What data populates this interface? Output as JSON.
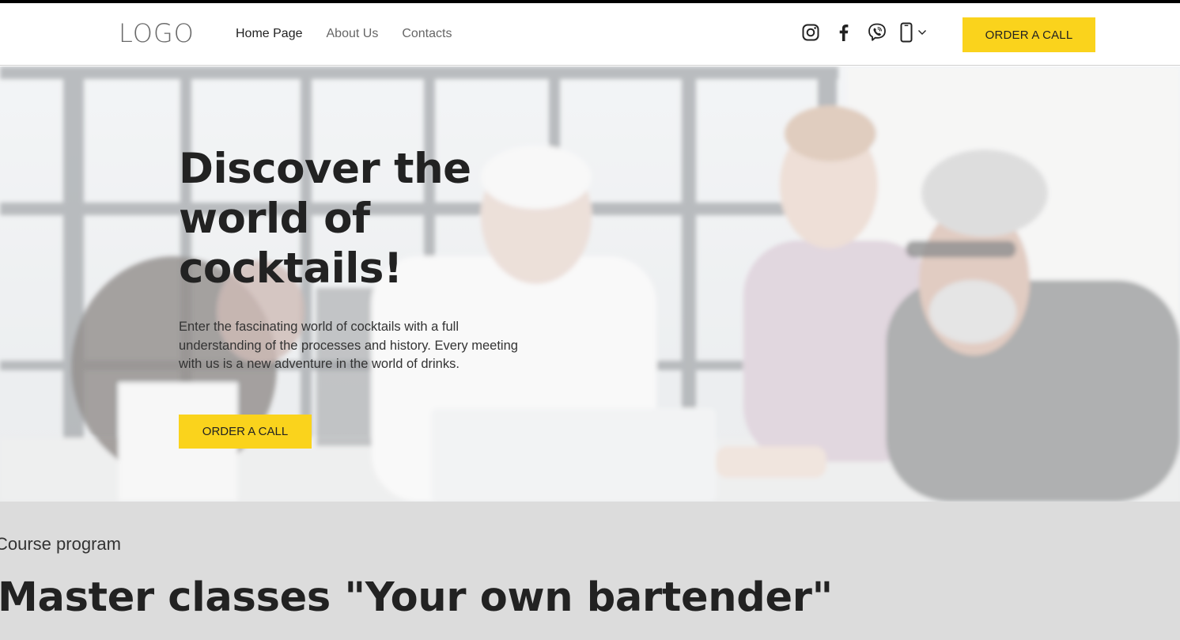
{
  "header": {
    "logo": "LOGO",
    "nav": [
      {
        "label": "Home Page"
      },
      {
        "label": "About Us"
      },
      {
        "label": "Contacts"
      }
    ],
    "social_icons": [
      "instagram-icon",
      "facebook-icon",
      "viber-icon",
      "phone-icon",
      "chevron-down-icon"
    ],
    "order_button": "ORDER A CALL"
  },
  "hero": {
    "title": "Discover the world of cocktails!",
    "text": "Enter the fascinating world of cocktails with a full understanding of the processes and history. Every meeting with us is a new adventure in the world of drinks.",
    "button": "ORDER A CALL"
  },
  "course": {
    "label": "Course program",
    "title": "Master classes \"Your own bartender\""
  },
  "colors": {
    "accent": "#fad31c",
    "text": "#222222",
    "section_bg": "#dcdcdc"
  }
}
